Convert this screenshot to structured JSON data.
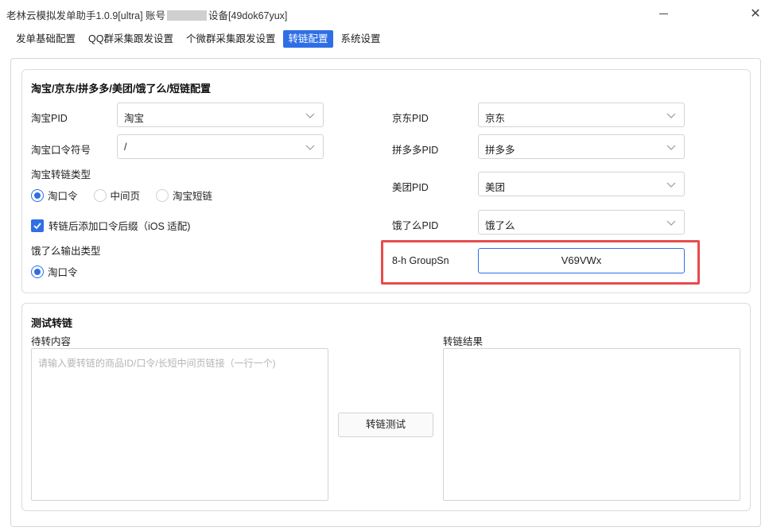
{
  "window": {
    "title_prefix": "老林云模拟发单助手1.0.9[ultra] 账号",
    "title_suffix": "设备[49dok67yux]",
    "close_glyph": "✕"
  },
  "tabs": [
    {
      "label": "发单基础配置",
      "active": false
    },
    {
      "label": "QQ群采集跟发设置",
      "active": false
    },
    {
      "label": "个微群采集跟发设置",
      "active": false
    },
    {
      "label": "转链配置",
      "active": true
    },
    {
      "label": "系统设置",
      "active": false
    }
  ],
  "config": {
    "heading": "淘宝/京东/拼多多/美团/饿了么/短链配置",
    "taobao_pid": {
      "label": "淘宝PID",
      "value": "淘宝"
    },
    "taobao_token": {
      "label": "淘宝口令符号",
      "value": "/"
    },
    "taobao_link_type": {
      "label": "淘宝转链类型",
      "options": [
        {
          "label": "淘口令",
          "selected": true
        },
        {
          "label": "中间页",
          "selected": false
        },
        {
          "label": "淘宝短链",
          "selected": false
        }
      ]
    },
    "ios_suffix": {
      "label": "转链后添加口令后缀（iOS 适配)",
      "checked": true
    },
    "eleme_output": {
      "label": "饿了么输出类型",
      "options": [
        {
          "label": "淘口令",
          "selected": true
        }
      ]
    },
    "jd_pid": {
      "label": "京东PID",
      "value": "京东"
    },
    "pdd_pid": {
      "label": "拼多多PID",
      "value": "拼多多"
    },
    "meituan_pid": {
      "label": "美团PID",
      "value": "美团"
    },
    "eleme_pid": {
      "label": "饿了么PID",
      "value": "饿了么"
    },
    "group_sn": {
      "label": "8-h GroupSn",
      "value": "V69VWx"
    }
  },
  "test": {
    "heading": "测试转链",
    "input_label": "待转内容",
    "input_placeholder": "请输入要转链的商品ID/口令/长短中间页链接（一行一个)",
    "result_label": "转链结果",
    "button_label": "转链测试"
  },
  "colors": {
    "accent": "#2f6fe6",
    "highlight": "#e84b4b"
  },
  "icons": {
    "select_arrow": "chevron-down-icon",
    "check": "check-icon",
    "close": "close-icon",
    "minimize": "minimize-icon"
  }
}
